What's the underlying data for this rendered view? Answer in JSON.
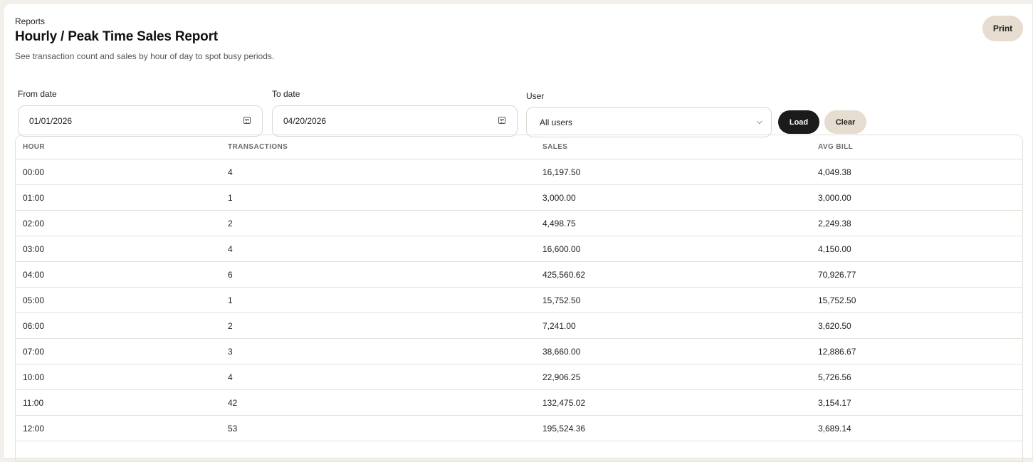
{
  "header": {
    "breadcrumb": "Reports",
    "title": "Hourly / Peak Time Sales Report",
    "subtitle": "See transaction count and sales by hour of day to spot busy periods.",
    "print_label": "Print"
  },
  "filters": {
    "from_label": "From date",
    "from_value": "01/01/2026",
    "to_label": "To date",
    "to_value": "04/20/2026",
    "user_label": "User",
    "user_value": "All users",
    "load_label": "Load",
    "clear_label": "Clear"
  },
  "icons": {
    "date_picker": "calendar-icon",
    "select": "chevron-down-icon"
  },
  "colors": {
    "primary_button": "#1b1b1b",
    "secondary_button": "#e6dccf",
    "page_background": "#f3efea"
  },
  "table": {
    "columns": [
      "HOUR",
      "TRANSACTIONS",
      "SALES",
      "AVG BILL"
    ],
    "rows": [
      [
        "00:00",
        "4",
        "16,197.50",
        "4,049.38"
      ],
      [
        "01:00",
        "1",
        "3,000.00",
        "3,000.00"
      ],
      [
        "02:00",
        "2",
        "4,498.75",
        "2,249.38"
      ],
      [
        "03:00",
        "4",
        "16,600.00",
        "4,150.00"
      ],
      [
        "04:00",
        "6",
        "425,560.62",
        "70,926.77"
      ],
      [
        "05:00",
        "1",
        "15,752.50",
        "15,752.50"
      ],
      [
        "06:00",
        "2",
        "7,241.00",
        "3,620.50"
      ],
      [
        "07:00",
        "3",
        "38,660.00",
        "12,886.67"
      ],
      [
        "10:00",
        "4",
        "22,906.25",
        "5,726.56"
      ],
      [
        "11:00",
        "42",
        "132,475.02",
        "3,154.17"
      ],
      [
        "12:00",
        "53",
        "195,524.36",
        "3,689.14"
      ]
    ]
  }
}
